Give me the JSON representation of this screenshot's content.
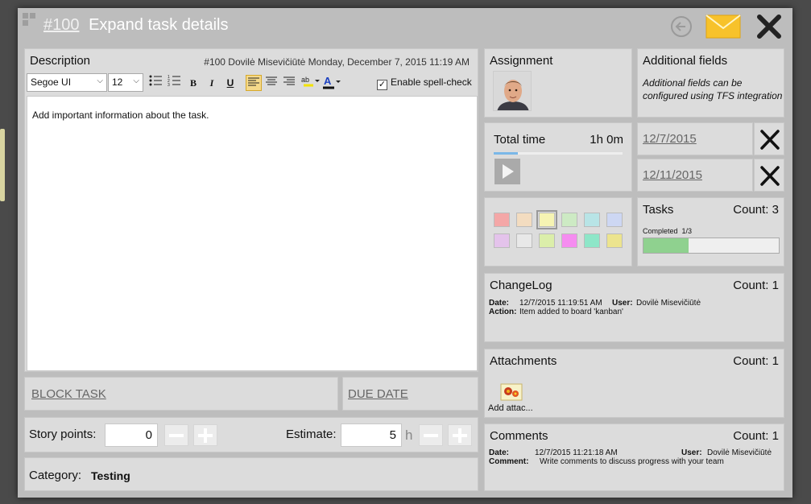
{
  "header": {
    "task_number": "#100",
    "title": "Expand task details"
  },
  "description": {
    "title": "Description",
    "meta": "#100  Dovilė Misevičiūtė  Monday, December 7, 2015 11:19 AM",
    "font": "Segoe UI",
    "font_size": "12",
    "spellcheck_label": "Enable spell-check",
    "spellcheck_checked": true,
    "content": "Add important information about the task."
  },
  "actions": {
    "block_task": "BLOCK TASK",
    "due_date": "DUE DATE"
  },
  "estimation": {
    "story_points_label": "Story points:",
    "story_points_value": "0",
    "estimate_label": "Estimate:",
    "estimate_value": "5",
    "estimate_unit": "h"
  },
  "category": {
    "label": "Category:",
    "value": "Testing"
  },
  "assignment": {
    "title": "Assignment"
  },
  "additional_fields": {
    "title": "Additional fields",
    "note": "Additional fields can be configured using TFS integration"
  },
  "time": {
    "title": "Total time",
    "value": "1h 0m"
  },
  "dates": [
    "12/7/2015",
    "12/11/2015"
  ],
  "colors": {
    "swatches": [
      "#f4a7a7",
      "#f3dcc0",
      "#f6f4b3",
      "#cdeac4",
      "#b8e4e6",
      "#cdd7f3",
      "#e4c3eb",
      "#e8e8e8",
      "#dbeeaa",
      "#f58cf0",
      "#8ee6c8",
      "#ece48e"
    ],
    "selected_index": 2
  },
  "tasks": {
    "title": "Tasks",
    "count": "Count: 3",
    "completed_label": "Completed",
    "completed_value": "1/3",
    "progress_fraction": 0.333,
    "progress_color": "#8fd18f"
  },
  "changelog": {
    "title": "ChangeLog",
    "count": "Count: 1",
    "date_label": "Date:",
    "date_value": "12/7/2015 11:19:51 AM",
    "user_label": "User:",
    "user_value": "Dovilė Misevičiūtė",
    "action_label": "Action:",
    "action_value": "Item added to board 'kanban'"
  },
  "attachments": {
    "title": "Attachments",
    "count": "Count: 1",
    "add_label": "Add attac..."
  },
  "comments": {
    "title": "Comments",
    "count": "Count: 1",
    "date_label": "Date:",
    "date_value": "12/7/2015 11:21:18 AM",
    "user_label": "User:",
    "user_value": "Dovilė Misevičiūtė",
    "comment_label": "Comment:",
    "comment_value": "Write comments to discuss progress with your team"
  }
}
